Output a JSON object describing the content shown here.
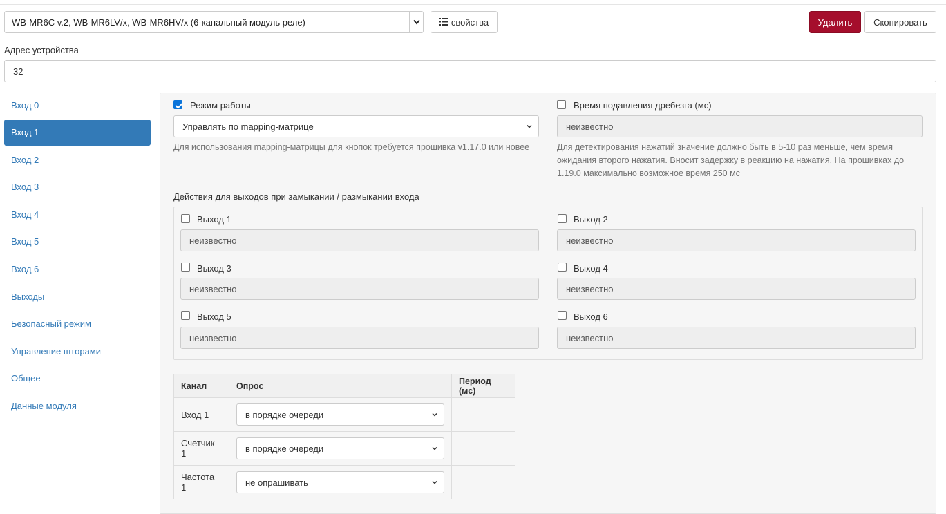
{
  "header": {
    "device_select_value": "WB-MR6C v.2, WB-MR6LV/x, WB-MR6HV/x (6-канальный модуль реле)",
    "properties_button": "свойства",
    "delete_button": "Удалить",
    "copy_button": "Скопировать"
  },
  "address": {
    "label": "Адрес устройства",
    "value": "32"
  },
  "sidebar": {
    "items": [
      {
        "label": "Вход 0",
        "active": false
      },
      {
        "label": "Вход 1",
        "active": true
      },
      {
        "label": "Вход 2",
        "active": false
      },
      {
        "label": "Вход 3",
        "active": false
      },
      {
        "label": "Вход 4",
        "active": false
      },
      {
        "label": "Вход 5",
        "active": false
      },
      {
        "label": "Вход 6",
        "active": false
      },
      {
        "label": "Выходы",
        "active": false
      },
      {
        "label": "Безопасный режим",
        "active": false
      },
      {
        "label": "Управление шторами",
        "active": false
      },
      {
        "label": "Общее",
        "active": false
      },
      {
        "label": "Данные модуля",
        "active": false
      }
    ]
  },
  "main": {
    "mode": {
      "label": "Режим работы",
      "checked": true,
      "value": "Управлять по mapping-матрице",
      "help": "Для использования mapping-матрицы для кнопок требуется прошивка v1.17.0 или новее"
    },
    "debounce": {
      "label": "Время подавления дребезга (мс)",
      "checked": false,
      "value": "неизвестно",
      "help": "Для детектирования нажатий значение должно быть в 5-10 раз меньше, чем время ожидания второго нажатия. Вносит задержку в реакцию на нажатия. На прошивках до 1.19.0 максимально возможное время 250 мс"
    },
    "actions_title": "Действия для выходов при замыкании / размыкании входа",
    "outputs": [
      {
        "label": "Выход 1",
        "value": "неизвестно",
        "checked": false
      },
      {
        "label": "Выход 2",
        "value": "неизвестно",
        "checked": false
      },
      {
        "label": "Выход 3",
        "value": "неизвестно",
        "checked": false
      },
      {
        "label": "Выход 4",
        "value": "неизвестно",
        "checked": false
      },
      {
        "label": "Выход 5",
        "value": "неизвестно",
        "checked": false
      },
      {
        "label": "Выход 6",
        "value": "неизвестно",
        "checked": false
      }
    ],
    "table": {
      "headers": [
        "Канал",
        "Опрос",
        "Период (мс)"
      ],
      "rows": [
        {
          "channel": "Вход 1",
          "poll": "в порядке очереди",
          "period": ""
        },
        {
          "channel": "Счетчик 1",
          "poll": "в порядке очереди",
          "period": ""
        },
        {
          "channel": "Частота 1",
          "poll": "не опрашивать",
          "period": ""
        }
      ]
    }
  },
  "colors": {
    "accent": "#337ab7",
    "danger": "#a50e2c",
    "checkbox": "#0a74da"
  }
}
